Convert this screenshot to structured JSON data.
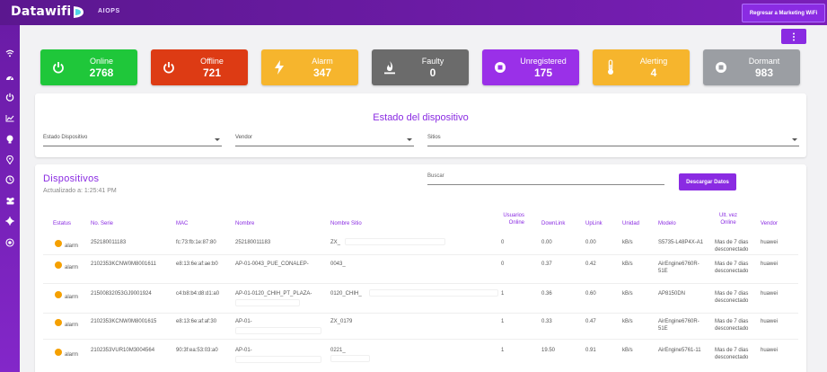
{
  "app": {
    "logo_text": "Datawifi",
    "app_name": "AIOPS",
    "return_button": "Regresar a Marketing WiFi"
  },
  "sidebar": {
    "icons": [
      "wifi-icon",
      "gauge-icon",
      "power-icon",
      "chart-line-icon",
      "lightbulb-icon",
      "map-pin-icon",
      "clock-icon",
      "users-icon",
      "settings-icon",
      "target-icon"
    ]
  },
  "cards": [
    {
      "label": "Online",
      "value": "2768",
      "color": "#1fc73a",
      "icon": "power-icon"
    },
    {
      "label": "Offline",
      "value": "721",
      "color": "#dd3b14",
      "icon": "power-icon"
    },
    {
      "label": "Alarm",
      "value": "347",
      "color": "#f6b52d",
      "icon": "bolt-icon"
    },
    {
      "label": "Faulty",
      "value": "0",
      "color": "#6b6b6b",
      "icon": "fire-icon"
    },
    {
      "label": "Unregistered",
      "value": "175",
      "color": "#9a30e8",
      "icon": "stop-icon"
    },
    {
      "label": "Alerting",
      "value": "4",
      "color": "#f6b52d",
      "icon": "thermometer-icon"
    },
    {
      "label": "Dormant",
      "value": "983",
      "color": "#9b9ea3",
      "icon": "stop-icon"
    }
  ],
  "status_panel": {
    "title": "Estado del dispositivo",
    "filters": [
      {
        "label": "Estado Dispositivo"
      },
      {
        "label": "Vendor"
      },
      {
        "label": "Sitios"
      }
    ]
  },
  "devices": {
    "title": "Dispositivos",
    "updated": "Actualizado a: 1:25:41 PM",
    "search_placeholder": "Buscar",
    "download_button": "Descargar Datos",
    "columns": [
      "Estatus",
      "No. Serie",
      "MAC",
      "Nombre",
      "Nombre Sitio",
      "Usuarios Online",
      "DownLink",
      "UpLink",
      "Unidad",
      "Modelo",
      "Ult. vez Online",
      "Vendor"
    ],
    "rows": [
      {
        "status": "alarm",
        "serie": "252180011183",
        "mac": "fc:73:fb:1e:87:80",
        "nombre": "252180011183",
        "sitio": "ZX_",
        "usuarios": "0",
        "down": "0.00",
        "up": "0.00",
        "unidad": "kB/s",
        "modelo": "S5735-L48P4X-A1",
        "ultima": "Mas de 7 dias desconectado",
        "vendor": "huawei"
      },
      {
        "status": "alarm",
        "serie": "2102353KCNW0M8001611",
        "mac": "e8:13:6e:af:ae:b0",
        "nombre": "AP-01-0043_PUE_CONALEP-",
        "sitio": "0043_",
        "usuarios": "0",
        "down": "0.37",
        "up": "0.42",
        "unidad": "kB/s",
        "modelo": "AirEngine6760R-51E",
        "ultima": "Mas de 7 dias desconectado",
        "vendor": "huawei"
      },
      {
        "status": "alarm",
        "serie": "21500832053GJ9001924",
        "mac": "c4:b8:b4:d8:d1:a0",
        "nombre": "AP-01-0120_CHIH_PT_PLAZA-",
        "sitio": "0120_CHIH_",
        "usuarios": "1",
        "down": "0.36",
        "up": "0.60",
        "unidad": "kB/s",
        "modelo": "AP8150DN",
        "ultima": "Mas de 7 dias desconectado",
        "vendor": "huawei"
      },
      {
        "status": "alarm",
        "serie": "2102353KCNW0M8001615",
        "mac": "e8:13:6e:af:af:30",
        "nombre": "AP-01-",
        "sitio": "ZX_0179",
        "usuarios": "1",
        "down": "0.33",
        "up": "0.47",
        "unidad": "kB/s",
        "modelo": "AirEngine6760R-51E",
        "ultima": "Mas de 7 dias desconectado",
        "vendor": "huawei"
      },
      {
        "status": "alarm",
        "serie": "2102353VUR10M3004564",
        "mac": "90:3f:ea:53:03:a0",
        "nombre": "AP-01-",
        "sitio": "0221_",
        "usuarios": "1",
        "down": "19.50",
        "up": "0.91",
        "unidad": "kB/s",
        "modelo": "AirEngine5761-11",
        "ultima": "Mas de 7 dias desconectado",
        "vendor": "huawei"
      }
    ]
  }
}
